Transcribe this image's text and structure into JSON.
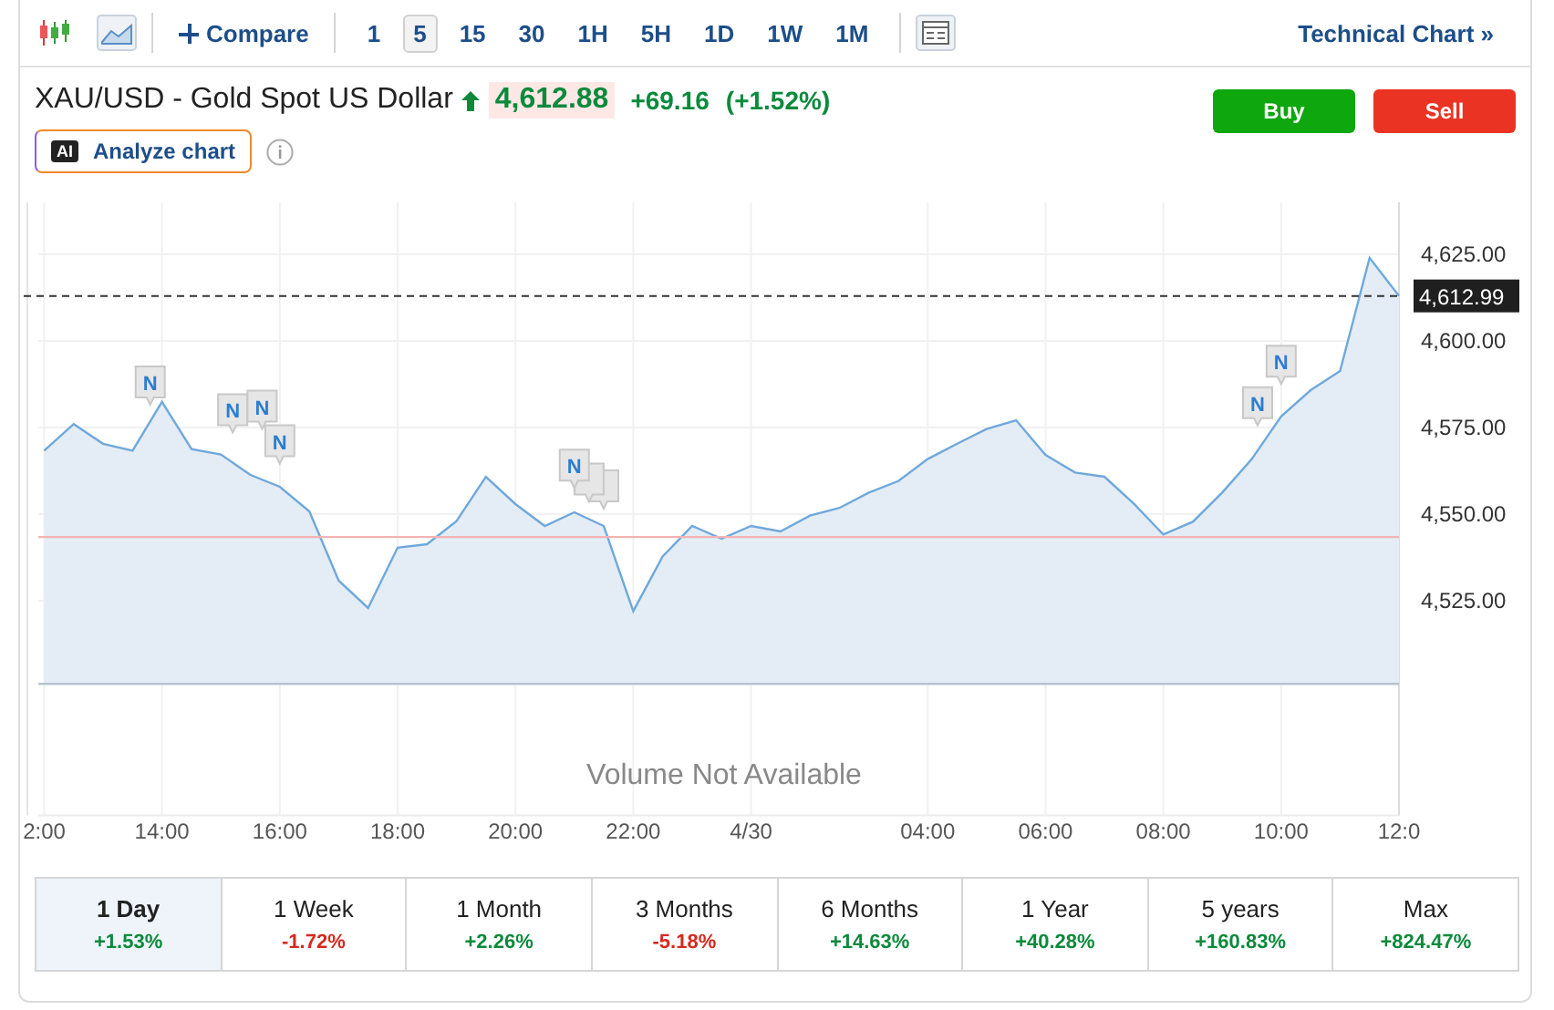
{
  "toolbar": {
    "compare": "Compare",
    "intervals": [
      {
        "label": "1",
        "selected": false
      },
      {
        "label": "5",
        "selected": true
      },
      {
        "label": "15",
        "selected": false
      },
      {
        "label": "30",
        "selected": false
      },
      {
        "label": "1H",
        "selected": false
      },
      {
        "label": "5H",
        "selected": false
      },
      {
        "label": "1D",
        "selected": false
      },
      {
        "label": "1W",
        "selected": false
      },
      {
        "label": "1M",
        "selected": false
      }
    ],
    "technical_chart": "Technical Chart »"
  },
  "quote": {
    "title": "XAU/USD - Gold Spot US Dollar",
    "rising": true,
    "price": "4,612.88",
    "change": "+69.16",
    "change_percent": "(+1.52%)"
  },
  "actions": [
    {
      "label": "Buy",
      "kind": "buy"
    },
    {
      "label": "Sell",
      "kind": "sell"
    }
  ],
  "analyze": {
    "badge": "AI",
    "label": "Analyze chart"
  },
  "chart": {
    "chart_data": {
      "type": "area",
      "grid": true,
      "ylim": [
        4463,
        4640
      ],
      "categories": [
        "2:00",
        null,
        null,
        null,
        "14:00",
        null,
        null,
        null,
        "16:00",
        null,
        null,
        null,
        "18:00",
        null,
        null,
        null,
        "20:00",
        null,
        null,
        null,
        "22:00",
        null,
        null,
        null,
        "4/30",
        null,
        null,
        null,
        null,
        null,
        "04:00",
        null,
        null,
        null,
        "06:00",
        null,
        null,
        null,
        "08:00",
        null,
        null,
        null,
        "10:00",
        null,
        null,
        null,
        "12:0"
      ],
      "series": [
        {
          "color": "#6fa8dc",
          "values": [
            4568.3,
            4576.0,
            4570.3,
            4568.3,
            4582.4,
            4568.8,
            4567.2,
            4561.3,
            4557.9,
            4550.8,
            4530.8,
            4522.9,
            4540.3,
            4541.3,
            4548.0,
            4560.8,
            4552.9,
            4546.6,
            4550.5,
            4546.6,
            4522.0,
            4537.8,
            4546.6,
            4542.9,
            4546.6,
            4545.0,
            4549.6,
            4551.8,
            4556.2,
            4559.5,
            4565.9,
            4570.3,
            4574.6,
            4577.1,
            4567.1,
            4562.0,
            4560.8,
            4553.0,
            4544.1,
            4547.8,
            4556.2,
            4565.9,
            4578.2,
            4585.8,
            4591.3,
            4624.0,
            4613.0
          ]
        }
      ],
      "yticks": [
        {
          "value": 4525,
          "label": "4,525.00"
        },
        {
          "value": 4550,
          "label": "4,550.00"
        },
        {
          "value": 4575,
          "label": "4,575.00"
        },
        {
          "value": 4600,
          "label": "4,600.00"
        },
        {
          "value": 4625,
          "label": "4,625.00"
        }
      ],
      "ref_lines": [
        {
          "axis": "y",
          "value": 4612.99,
          "label": "4,612.99",
          "color": "#333333"
        },
        {
          "axis": "y",
          "value": 4543.4,
          "color": "#f3b3b3"
        },
        {
          "axis": "y",
          "value": 4501,
          "color": "#b7c3cf"
        }
      ]
    },
    "news_markers": [
      "N",
      "N",
      "N",
      "N",
      "N",
      "N",
      "N"
    ],
    "volume_note": "Volume Not Available"
  },
  "periods": [
    {
      "label": "1 Day",
      "change": "+1.53%",
      "color": "#0b8a3c",
      "selected": true
    },
    {
      "label": "1 Week",
      "change": "-1.72%",
      "color": "#d62a1e",
      "selected": false
    },
    {
      "label": "1 Month",
      "change": "+2.26%",
      "color": "#0b8a3c",
      "selected": false
    },
    {
      "label": "3 Months",
      "change": "-5.18%",
      "color": "#d62a1e",
      "selected": false
    },
    {
      "label": "6 Months",
      "change": "+14.63%",
      "color": "#0b8a3c",
      "selected": false
    },
    {
      "label": "1 Year",
      "change": "+40.28%",
      "color": "#0b8a3c",
      "selected": false
    },
    {
      "label": "5 years",
      "change": "+160.83%",
      "color": "#0b8a3c",
      "selected": false
    },
    {
      "label": "Max",
      "change": "+824.47%",
      "color": "#0b8a3c",
      "selected": false
    }
  ]
}
